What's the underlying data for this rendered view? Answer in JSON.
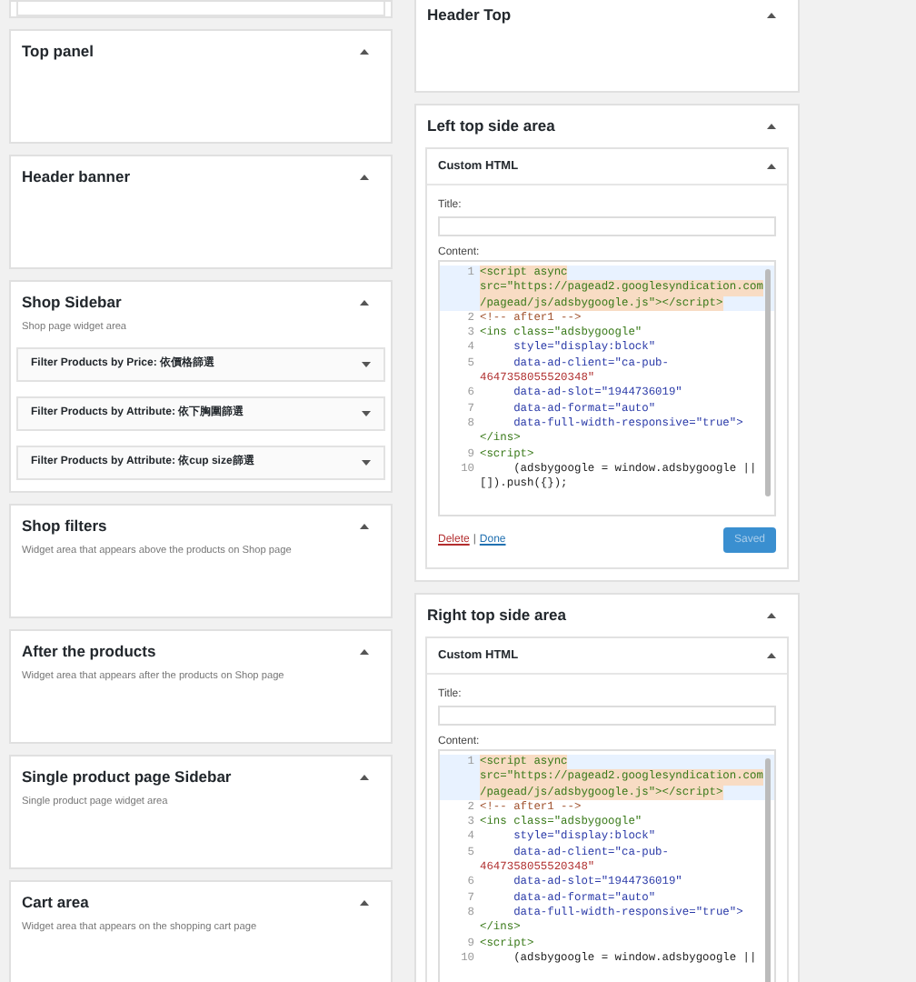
{
  "left_column": {
    "panels": [
      {
        "kind": "stub"
      },
      {
        "kind": "area",
        "title": "Top panel",
        "expanded": true
      },
      {
        "kind": "area",
        "title": "Header banner",
        "expanded": true
      },
      {
        "kind": "area",
        "title": "Shop Sidebar",
        "description": "Shop page widget area",
        "expanded": true,
        "widgets": [
          {
            "title": "Filter Products by Price: 依價格篩選",
            "expanded": false
          },
          {
            "title": "Filter Products by Attribute: 依下胸圍篩選",
            "expanded": false
          },
          {
            "title": "Filter Products by Attribute: 依cup size篩選",
            "expanded": false
          }
        ]
      },
      {
        "kind": "area",
        "title": "Shop filters",
        "description": "Widget area that appears above the products on Shop page",
        "expanded": true
      },
      {
        "kind": "area",
        "title": "After the products",
        "description": "Widget area that appears after the products on Shop page",
        "expanded": true
      },
      {
        "kind": "area",
        "title": "Single product page Sidebar",
        "description": "Single product page widget area",
        "expanded": true
      },
      {
        "kind": "area",
        "title": "Cart area",
        "description": "Widget area that appears on the shopping cart page",
        "expanded": true
      }
    ]
  },
  "right_column": {
    "panels": [
      {
        "kind": "area",
        "title": "Header Top",
        "expanded": true
      },
      {
        "kind": "area",
        "title": "Left top side area",
        "expanded": true,
        "widgets": [
          {
            "title": "Custom HTML",
            "expanded": true,
            "title_label": "Title:",
            "content_label": "Content:",
            "code_rows": [
              {
                "number": "1",
                "text": "<script async",
                "kind": "tag",
                "active": true
              },
              {
                "text": "src=\"https://pagead2.googlesyndication.com",
                "kind": "tag",
                "active": true
              },
              {
                "text": "/pagead/js/adsbygoogle.js\"></script>",
                "kind": "tag",
                "active": true
              },
              {
                "number": "2",
                "text": "<!-- after1 -->",
                "kind": "comment",
                "active": false
              },
              {
                "number": "3",
                "text": "<ins class=\"adsbygoogle\"",
                "kind": "tag",
                "active": false
              },
              {
                "number": "4",
                "text": "     style=\"display:block\"",
                "kind": "attr",
                "active": false
              },
              {
                "number": "5",
                "text": "     data-ad-client=\"ca-pub-",
                "kind": "attr",
                "active": false
              },
              {
                "text": "4647358055520348\"",
                "kind": "string",
                "active": false
              },
              {
                "number": "6",
                "text": "     data-ad-slot=\"1944736019\"",
                "kind": "attr",
                "active": false
              },
              {
                "number": "7",
                "text": "     data-ad-format=\"auto\"",
                "kind": "attr",
                "active": false
              },
              {
                "number": "8",
                "text": "     data-full-width-responsive=\"true\">",
                "kind": "attr",
                "active": false
              },
              {
                "text": "</ins>",
                "kind": "tag",
                "active": false
              },
              {
                "number": "9",
                "text": "<script>",
                "kind": "tag",
                "active": false
              },
              {
                "number": "10",
                "text": "     (adsbygoogle = window.adsbygoogle ||",
                "kind": "code",
                "active": false
              },
              {
                "text": "[]).push({});",
                "kind": "code",
                "active": false
              }
            ],
            "actions": {
              "delete": "Delete",
              "separator": "|",
              "done": "Done",
              "save": {
                "label": "Saved",
                "disabled": true
              }
            }
          }
        ]
      },
      {
        "kind": "area",
        "title": "Right top side area",
        "expanded": true,
        "widgets": [
          {
            "title": "Custom HTML",
            "expanded": true,
            "title_label": "Title:",
            "content_label": "Content:",
            "code_rows": [
              {
                "number": "1",
                "text": "<script async",
                "kind": "tag",
                "active": true
              },
              {
                "text": "src=\"https://pagead2.googlesyndication.com",
                "kind": "tag",
                "active": true
              },
              {
                "text": "/pagead/js/adsbygoogle.js\"></script>",
                "kind": "tag",
                "active": true
              },
              {
                "number": "2",
                "text": "<!-- after1 -->",
                "kind": "comment",
                "active": false
              },
              {
                "number": "3",
                "text": "<ins class=\"adsbygoogle\"",
                "kind": "tag",
                "active": false
              },
              {
                "number": "4",
                "text": "     style=\"display:block\"",
                "kind": "attr",
                "active": false
              },
              {
                "number": "5",
                "text": "     data-ad-client=\"ca-pub-",
                "kind": "attr",
                "active": false
              },
              {
                "text": "4647358055520348\"",
                "kind": "string",
                "active": false
              },
              {
                "number": "6",
                "text": "     data-ad-slot=\"1944736019\"",
                "kind": "attr",
                "active": false
              },
              {
                "number": "7",
                "text": "     data-ad-format=\"auto\"",
                "kind": "attr",
                "active": false
              },
              {
                "number": "8",
                "text": "     data-full-width-responsive=\"true\">",
                "kind": "attr",
                "active": false
              },
              {
                "text": "</ins>",
                "kind": "tag",
                "active": false
              },
              {
                "number": "9",
                "text": "<script>",
                "kind": "tag",
                "active": false
              },
              {
                "number": "10",
                "text": "     (adsbygoogle = window.adsbygoogle ||",
                "kind": "code",
                "active": false
              }
            ]
          }
        ]
      }
    ]
  }
}
